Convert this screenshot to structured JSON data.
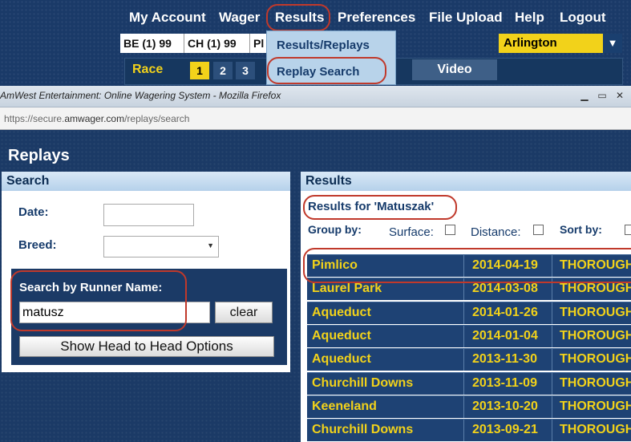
{
  "nav": {
    "items": [
      "My Account",
      "Wager",
      "Results",
      "Preferences",
      "File Upload",
      "Help",
      "Logout"
    ]
  },
  "odds": {
    "cells": [
      "BE (1) 99",
      "CH (1) 99",
      "Pl"
    ]
  },
  "track": {
    "selected": "Arlington"
  },
  "race": {
    "label": "Race",
    "numbers": [
      "1",
      "2",
      "3"
    ],
    "video_label": "Video"
  },
  "results_menu": {
    "items": [
      "Results/Replays",
      "Replay Search"
    ]
  },
  "browser": {
    "title": "AmWest Entertainment: Online Wagering System - Mozilla Firefox",
    "url_prefix": "https://secure.",
    "url_domain": "amwager.com",
    "url_path": "/replays/search"
  },
  "page": {
    "title": "Replays"
  },
  "search": {
    "header": "Search",
    "date_label": "Date:",
    "date_value": "",
    "breed_label": "Breed:",
    "breed_value": "",
    "runner_label": "Search by Runner Name:",
    "runner_value": "matusz",
    "clear_label": "clear",
    "h2h_label": "Show Head to Head Options"
  },
  "results": {
    "header": "Results",
    "results_for": "Results for 'Matuszak'",
    "group_by_label": "Group by:",
    "surface_label": "Surface:",
    "distance_label": "Distance:",
    "sort_by_label": "Sort by:",
    "rows": [
      {
        "track": "Pimlico",
        "date": "2014-04-19",
        "breed": "THOROUGH"
      },
      {
        "track": "Laurel Park",
        "date": "2014-03-08",
        "breed": "THOROUGH"
      },
      {
        "track": "Aqueduct",
        "date": "2014-01-26",
        "breed": "THOROUGH"
      },
      {
        "track": "Aqueduct",
        "date": "2014-01-04",
        "breed": "THOROUGH"
      },
      {
        "track": "Aqueduct",
        "date": "2013-11-30",
        "breed": "THOROUGH"
      },
      {
        "track": "Churchill Downs",
        "date": "2013-11-09",
        "breed": "THOROUGH"
      },
      {
        "track": "Keeneland",
        "date": "2013-10-20",
        "breed": "THOROUGH"
      },
      {
        "track": "Churchill Downs",
        "date": "2013-09-21",
        "breed": "THOROUGH"
      }
    ]
  },
  "colors": {
    "page_bg": "#1b3a66",
    "accent_yellow": "#f2d21a",
    "annotation_red": "#c0392b",
    "panel_header": "#b5d1ea"
  }
}
